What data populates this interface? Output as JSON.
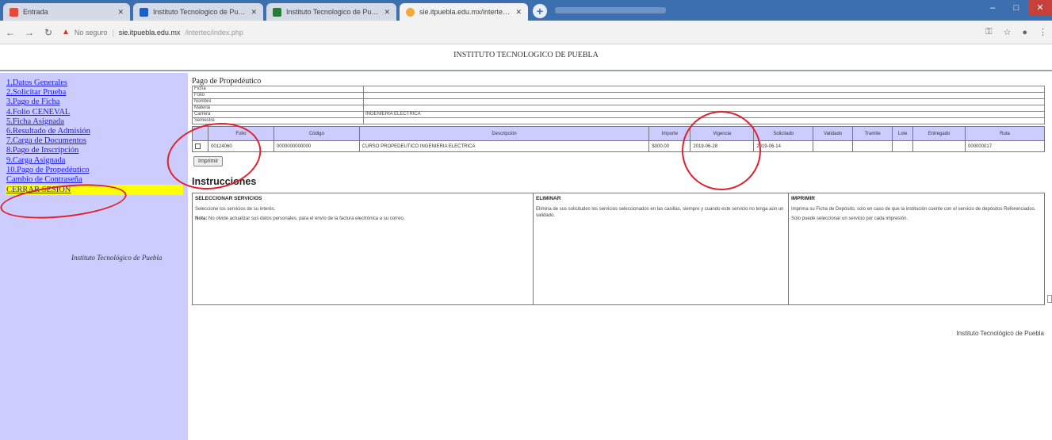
{
  "browser": {
    "tabs": [
      {
        "label": "Entrada",
        "favicon_color": "#e24b3b"
      },
      {
        "label": "Instituto Tecnologico de Puebla · Vista",
        "favicon_color": "#1f5fbf"
      },
      {
        "label": "Instituto Tecnologico de Puebla · Vista",
        "favicon_color": "#2a7a3a"
      },
      {
        "label": "sie.itpuebla.edu.mx/intertec/index.php",
        "favicon_color": "#f2a93b"
      }
    ],
    "new_tab_label": "+",
    "address": {
      "security": "No seguro",
      "host": "sie.itpuebla.edu.mx",
      "path": "/intertec/index.php"
    }
  },
  "header": {
    "title": "INSTITUTO TECNOLOGICO DE PUEBLA"
  },
  "sidebar": {
    "items": [
      "1.Datos Generales",
      "2.Solicitar Prueba",
      "3.Pago de Ficha",
      "4.Folio CENEVAL",
      "5.Ficha Asignada",
      "6.Resultado de Admisión",
      "7.Carga de Documentos",
      "8.Pago de Inscripción",
      "9.Carga Asignada",
      "10.Pago de Propedéutico",
      "Cambio de Contraseña"
    ],
    "logout": "CERRAR SESION",
    "footer": "Instituto Tecnológico de Puebla"
  },
  "main": {
    "section_title": "Pago de Propedéutico",
    "info_rows": [
      {
        "label": "Ficha",
        "value": ""
      },
      {
        "label": "Folio",
        "value": ""
      },
      {
        "label": "Nombre",
        "value": ""
      },
      {
        "label": "Materia",
        "value": ""
      },
      {
        "label": "Carrera",
        "value": "INGENIERIA ELECTRICA"
      },
      {
        "label": "Semestre",
        "value": ""
      }
    ],
    "table": {
      "headers": [
        "",
        "Folio",
        "Código",
        "Descripción",
        "Importe",
        "Vigencia",
        "Solicitado",
        "Validado",
        "Tramite",
        "Lote",
        "Entregado",
        "Ruta"
      ],
      "rows": [
        [
          "☑",
          "00124060",
          "0000000000000",
          "CURSO PROPEDEUTICO INGENIERIA ELECTRICA",
          "$000.00",
          "2019-06-28",
          "2019-06-14",
          "",
          "",
          "",
          "",
          "000000017"
        ]
      ]
    },
    "pay_button": "Imprimir",
    "instructions_title": "Instrucciones",
    "instructions": [
      {
        "title": "SELECCIONAR SERVICIOS",
        "paragraphs": [
          "Seleccione los servicios de su interés.",
          "Nota: No olvide actualizar sus datos personales, para el envío de la factura electrónica a su correo."
        ]
      },
      {
        "title": "ELIMINAR",
        "paragraphs": [
          "Elimina de sus solicitudes los servicios seleccionados en las casillas, siempre y cuando este servicio no tenga aún un validado."
        ]
      },
      {
        "title": "IMPRIMIR",
        "paragraphs": [
          "Imprima su Ficha de Depósito, solo en caso de que la institución cuente con el servicio de depósitos Referenciados.",
          "Solo puede seleccionar un servicio por cada impresión."
        ]
      }
    ],
    "footer": "Instituto Tecnológico de Puebla"
  },
  "colors": {
    "sidebar_bg": "#ccccff",
    "logout_bg": "#ffff00",
    "annotation": "#e0212e",
    "link": "#1a1aee"
  }
}
